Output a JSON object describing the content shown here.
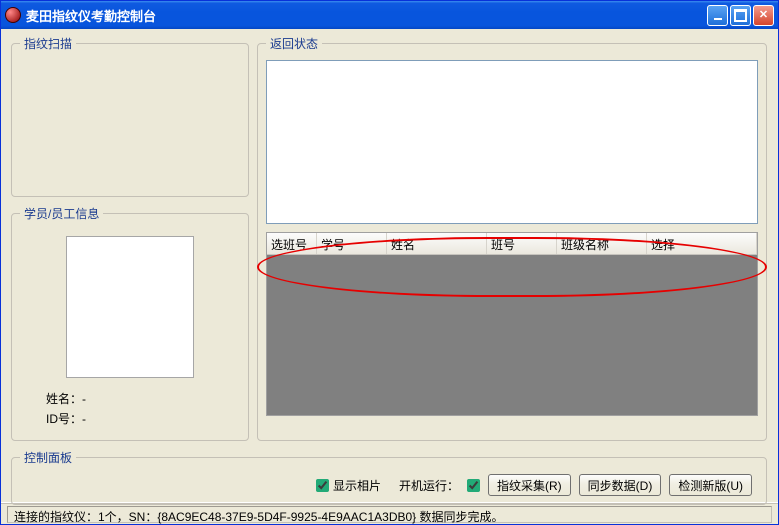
{
  "titlebar": {
    "title": "麦田指纹仪考勤控制台"
  },
  "fp_scan": {
    "legend": "指纹扫描"
  },
  "emp_info": {
    "legend": "学员/员工信息",
    "name_label": "姓名：-",
    "id_label": "ID号：-"
  },
  "return_status": {
    "legend": "返回状态",
    "columns": {
      "c0": "选班号",
      "c1": "学号",
      "c2": "姓名",
      "c3": "班号",
      "c4": "班级名称",
      "c5": "选择"
    }
  },
  "ctrl_panel": {
    "legend": "控制面板",
    "show_photo": "显示相片",
    "boot_run": "开机运行：",
    "btn_collect": "指纹采集(R)",
    "btn_sync": "同步数据(D)",
    "btn_update": "检测新版(U)"
  },
  "statusbar": {
    "text": "连接的指纹仪：1个，SN：{8AC9EC48-37E9-5D4F-9925-4E9AAC1A3DB0} 数据同步完成。"
  }
}
